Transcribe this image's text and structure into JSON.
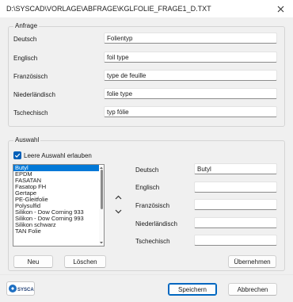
{
  "window": {
    "title": "D:\\SYSCAD\\VORLAGE\\ABFRAGE\\KGLFOLIE_FRAGE1_D.TXT"
  },
  "anfrage": {
    "title": "Anfrage",
    "rows": [
      {
        "label": "Deutsch",
        "value": "Folientyp"
      },
      {
        "label": "Englisch",
        "value": "foil type"
      },
      {
        "label": "Französisch",
        "value": "type de feuille"
      },
      {
        "label": "Niederländisch",
        "value": "folie type"
      },
      {
        "label": "Tschechisch",
        "value": "typ fólie"
      }
    ]
  },
  "auswahl": {
    "title": "Auswahl",
    "checkbox_label": "Leere Auswahl erlauben",
    "checkbox_checked": true,
    "list_items": [
      "Butyl",
      "EPDM",
      "FASATAN",
      "Fasatop FH",
      "Gertape",
      "PE-Gleitfolie",
      "Polysulfid",
      "Silikon - Dow Corning 933",
      "Silikon - Dow Corning 993",
      "Silikon schwarz",
      "TAN Folie"
    ],
    "selected_index": 0,
    "rows": [
      {
        "label": "Deutsch",
        "value": "Butyl"
      },
      {
        "label": "Englisch",
        "value": ""
      },
      {
        "label": "Französisch",
        "value": ""
      },
      {
        "label": "Niederländisch",
        "value": ""
      },
      {
        "label": "Tschechisch",
        "value": ""
      }
    ],
    "buttons": {
      "new": "Neu",
      "delete": "Löschen",
      "apply": "Übernehmen"
    }
  },
  "footer": {
    "logo_text": "SYSCAD",
    "save": "Speichern",
    "cancel": "Abbrechen"
  },
  "colors": {
    "accent": "#005fb8",
    "selection": "#0078d7"
  }
}
